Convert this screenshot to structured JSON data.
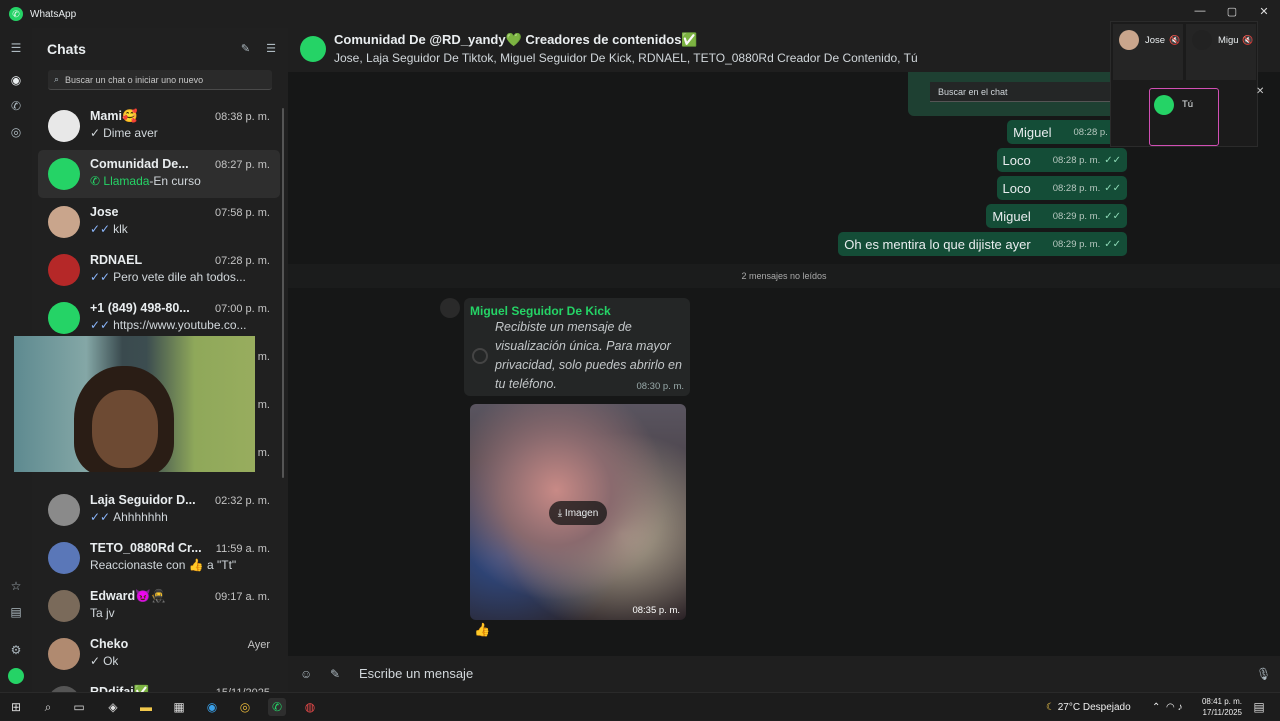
{
  "app": {
    "title": "WhatsApp"
  },
  "window_controls": {
    "minimize": "—",
    "maximize": "▢",
    "close": "✕"
  },
  "sidebar": {
    "title": "Chats",
    "search_placeholder": "Buscar un chat o iniciar uno nuevo",
    "chats": [
      {
        "name": "Mami🥰",
        "time": "08:38 p. m.",
        "ticks": "✓",
        "preview": "Dime aver",
        "avatar_color": "#e8e8e8"
      },
      {
        "name": "Comunidad De...",
        "time": "08:27 p. m.",
        "call_label": "Llamada",
        "preview": "-En curso",
        "avatar_color": "#25d366"
      },
      {
        "name": "Jose",
        "time": "07:58 p. m.",
        "ticks": "✓✓",
        "preview": "klk",
        "avatar_color": "#c9a58c"
      },
      {
        "name": "RDNAEL",
        "time": "07:28 p. m.",
        "ticks": "✓✓",
        "preview": "Pero vete dile ah todos...",
        "avatar_color": "#b52828"
      },
      {
        "name": "+1 (849) 498-80...",
        "time": "07:00 p. m.",
        "ticks": "✓✓",
        "preview": "https://www.youtube.co...",
        "avatar_color": "#25d366"
      },
      {
        "name": "",
        "time": "m.",
        "ticks": "",
        "preview": "",
        "avatar_color": "#333"
      },
      {
        "name": "",
        "time": "m.",
        "ticks": "",
        "preview": "",
        "avatar_color": "#333"
      },
      {
        "name": "",
        "time": "m.",
        "ticks": "",
        "preview": "",
        "avatar_color": "#333"
      },
      {
        "name": "Laja Seguidor D...",
        "time": "02:32 p. m.",
        "ticks": "✓✓",
        "preview": "Ahhhhhhh",
        "avatar_color": "#8a8a8a"
      },
      {
        "name": "TETO_0880Rd Cr...",
        "time": "11:59 a. m.",
        "ticks": "",
        "preview": "Reaccionaste con 👍 a \"Tt\"",
        "avatar_color": "#5a77b8"
      },
      {
        "name": "Edward😈🥷",
        "time": "09:17 a. m.",
        "ticks": "",
        "preview": "Ta jv",
        "avatar_color": "#7a6a5a"
      },
      {
        "name": "Cheko",
        "time": "Ayer",
        "ticks": "✓",
        "preview": "Ok",
        "avatar_color": "#b08a70"
      },
      {
        "name": "RDdifai✅",
        "time": "15/11/2025",
        "ticks": "",
        "preview": "",
        "avatar_color": "#555"
      }
    ]
  },
  "chat": {
    "title": "Comunidad De @RD_yandy💚  Creadores de contenidos✅",
    "members": "Jose, Laja Seguidor De Tiktok, Miguel Seguidor De Kick, RDNAEL, TETO_0880Rd Creador De Contenido, Tú",
    "search_placeholder": "Buscar en el chat",
    "outgoing": [
      {
        "text": "Miguel",
        "time": "08:28 p. m.",
        "ticks": "✓✓"
      },
      {
        "text": "Loco",
        "time": "08:28 p. m.",
        "ticks": "✓✓"
      },
      {
        "text": "Loco",
        "time": "08:28 p. m.",
        "ticks": "✓✓"
      },
      {
        "text": "Miguel",
        "time": "08:29 p. m.",
        "ticks": "✓✓"
      },
      {
        "text": "Oh es mentira lo que dijiste ayer",
        "time": "08:29 p. m.",
        "ticks": "✓✓"
      }
    ],
    "unread_label": "2 mensajes no leídos",
    "incoming": {
      "sender": "Miguel Seguidor De Kick",
      "text": "Recibiste un mensaje de visualización única. Para mayor privacidad, solo puedes abrirlo en tu teléfono.",
      "time": "08:30 p. m.",
      "image_label": "Imagen",
      "image_time": "08:35 p. m.",
      "reaction": "👍"
    },
    "compose_placeholder": "Escribe un mensaje"
  },
  "call": {
    "participants": [
      {
        "name": "Jose",
        "avatar_color": "#c9a58c"
      },
      {
        "name": "Migu",
        "avatar_color": "#222"
      }
    ],
    "self_name": "Tú"
  },
  "taskbar": {
    "weather": "27°C  Despejado",
    "time": "08:41 p. m.",
    "date": "17/11/2025"
  }
}
